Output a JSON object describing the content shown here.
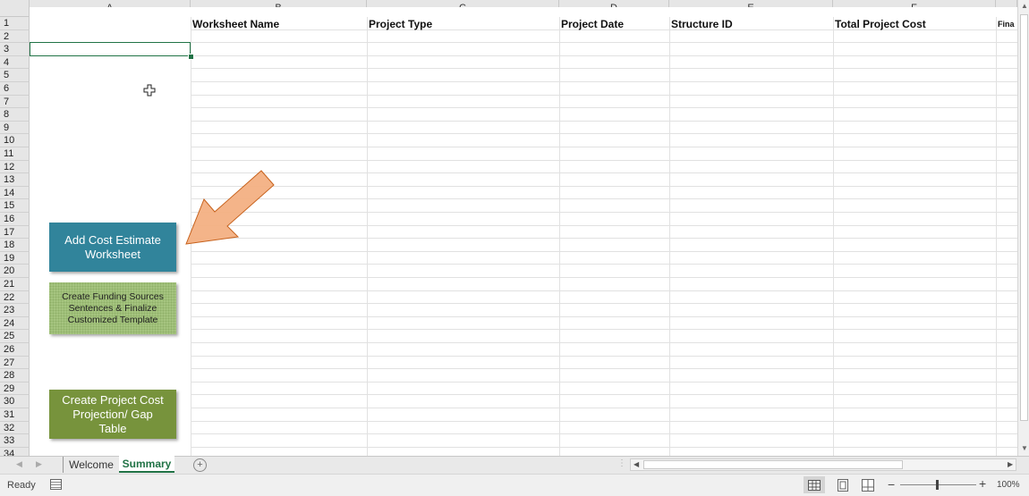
{
  "columns": [
    "A",
    "B",
    "C",
    "D",
    "E",
    "F"
  ],
  "row_numbers": [
    "1",
    "2",
    "3",
    "4",
    "5",
    "6",
    "7",
    "8",
    "9",
    "10",
    "11",
    "12",
    "13",
    "14",
    "15",
    "16",
    "17",
    "18",
    "19",
    "20",
    "21",
    "22",
    "23",
    "24",
    "25",
    "26",
    "27",
    "28",
    "29",
    "30",
    "31",
    "32",
    "33",
    "34"
  ],
  "header_row": {
    "B": "Worksheet Name",
    "C": "Project Type",
    "D": "Project Date",
    "E": "Structure ID",
    "F": "Total Project Cost",
    "G": "Fina"
  },
  "buttons": {
    "add_cost_estimate": "Add Cost Estimate Worksheet",
    "funding_sources": "Create Funding Sources Sentences & Finalize Customized Template",
    "projection_gap": "Create Project Cost Projection/ Gap Table"
  },
  "sheet_tabs": [
    "Welcome",
    "Summary"
  ],
  "active_tab": "Summary",
  "status": {
    "ready": "Ready",
    "zoom": "100%"
  },
  "colors": {
    "button_teal": "#31849b",
    "button_green_light": "#a5c47f",
    "button_green_dark": "#77933c",
    "arrow_orange": "#f4b183",
    "active_tab_text": "#217346"
  }
}
